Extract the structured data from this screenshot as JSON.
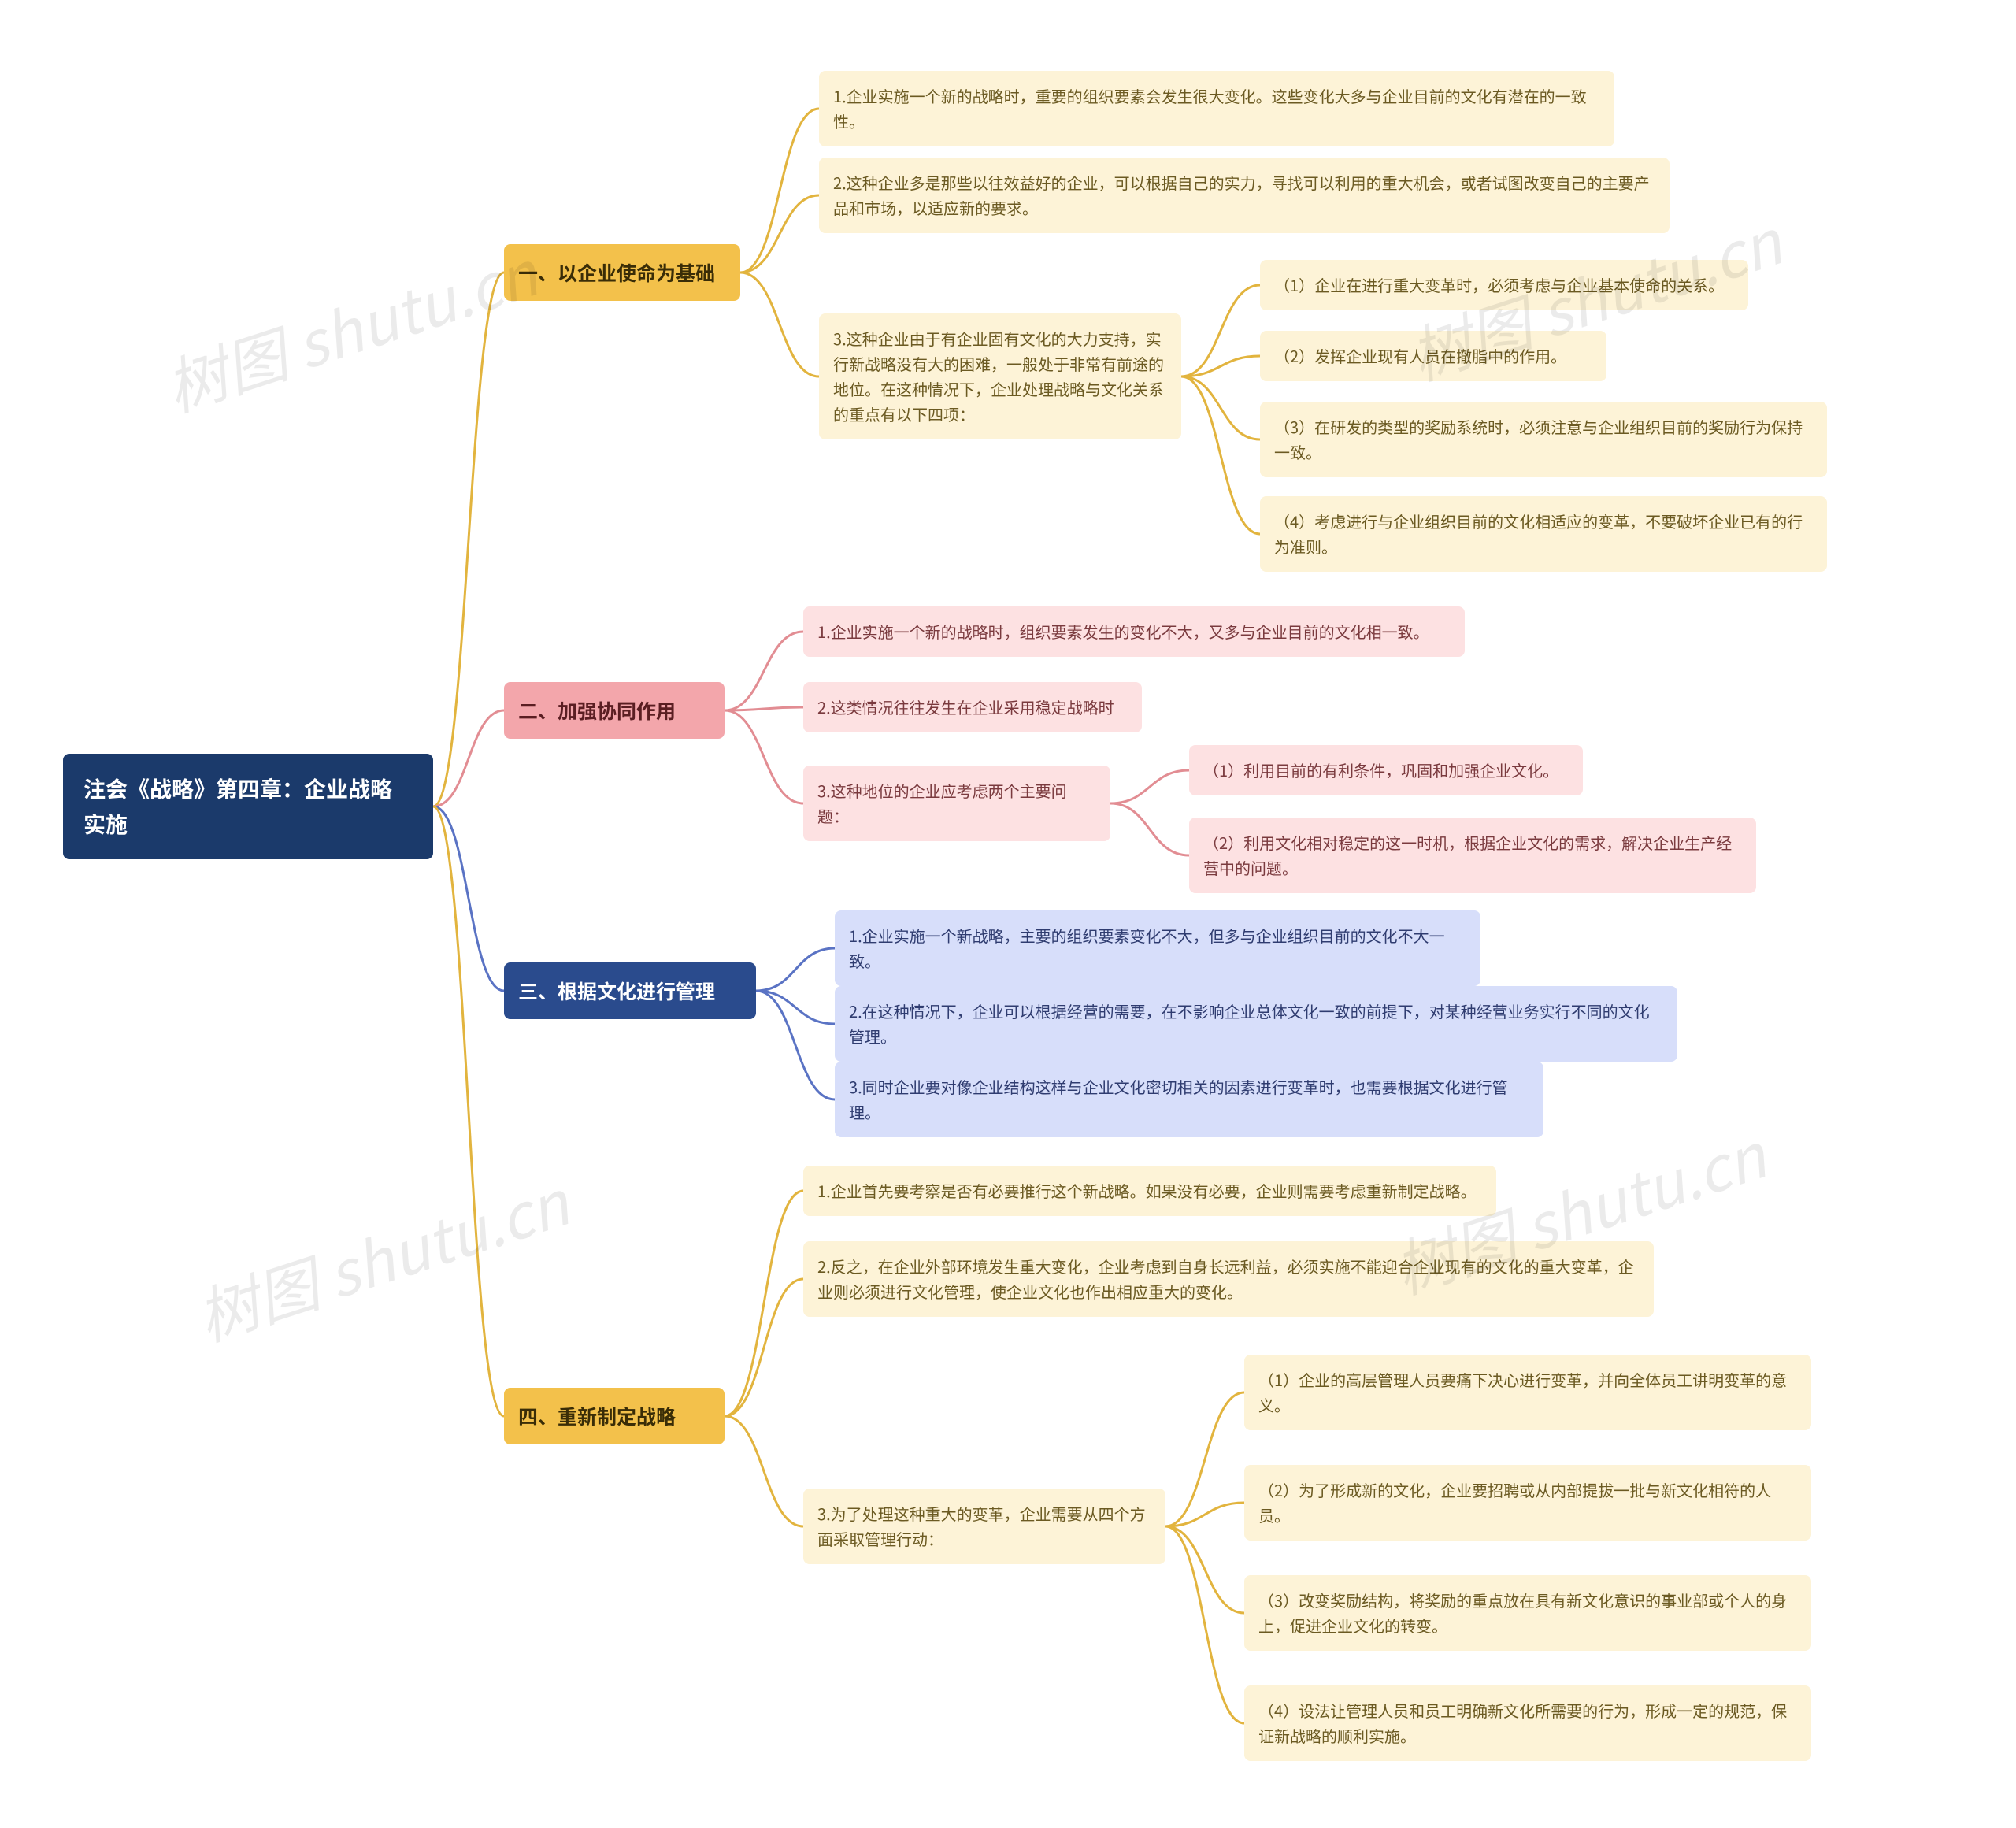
{
  "watermark_text": "树图 shutu.cn",
  "root": {
    "title": "注会《战略》第四章：企业战略实施"
  },
  "branches": [
    {
      "id": "b1",
      "label": "一、以企业使命为基础",
      "color": "yellow",
      "children": [
        {
          "id": "b1c1",
          "text": "1.企业实施一个新的战略时，重要的组织要素会发生很大变化。这些变化大多与企业目前的文化有潜在的一致性。"
        },
        {
          "id": "b1c2",
          "text": "2.这种企业多是那些以往效益好的企业，可以根据自己的实力，寻找可以利用的重大机会，或者试图改变自己的主要产品和市场，以适应新的要求。"
        },
        {
          "id": "b1c3",
          "text": "3.这种企业由于有企业固有文化的大力支持，实行新战略没有大的困难，一般处于非常有前途的地位。在这种情况下，企业处理战略与文化关系的重点有以下四项：",
          "children": [
            {
              "id": "b1c3a",
              "text": "（1）企业在进行重大变革时，必须考虑与企业基本使命的关系。"
            },
            {
              "id": "b1c3b",
              "text": "（2）发挥企业现有人员在撤脂中的作用。"
            },
            {
              "id": "b1c3c",
              "text": "（3）在研发的类型的奖励系统时，必须注意与企业组织目前的奖励行为保持一致。"
            },
            {
              "id": "b1c3d",
              "text": "（4）考虑进行与企业组织目前的文化相适应的变革，不要破坏企业已有的行为准则。"
            }
          ]
        }
      ]
    },
    {
      "id": "b2",
      "label": "二、加强协同作用",
      "color": "pink",
      "children": [
        {
          "id": "b2c1",
          "text": "1.企业实施一个新的战略时，组织要素发生的变化不大，又多与企业目前的文化相一致。"
        },
        {
          "id": "b2c2",
          "text": "2.这类情况往往发生在企业采用稳定战略时"
        },
        {
          "id": "b2c3",
          "text": "3.这种地位的企业应考虑两个主要问题：",
          "children": [
            {
              "id": "b2c3a",
              "text": "（1）利用目前的有利条件，巩固和加强企业文化。"
            },
            {
              "id": "b2c3b",
              "text": "（2）利用文化相对稳定的这一时机，根据企业文化的需求，解决企业生产经营中的问题。"
            }
          ]
        }
      ]
    },
    {
      "id": "b3",
      "label": "三、根据文化进行管理",
      "color": "blue",
      "children": [
        {
          "id": "b3c1",
          "text": "1.企业实施一个新战略，主要的组织要素变化不大，但多与企业组织目前的文化不大一致。"
        },
        {
          "id": "b3c2",
          "text": "2.在这种情况下，企业可以根据经营的需要，在不影响企业总体文化一致的前提下，对某种经营业务实行不同的文化管理。"
        },
        {
          "id": "b3c3",
          "text": "3.同时企业要对像企业结构这样与企业文化密切相关的因素进行变革时，也需要根据文化进行管理。"
        }
      ]
    },
    {
      "id": "b4",
      "label": "四、重新制定战略",
      "color": "yellow",
      "children": [
        {
          "id": "b4c1",
          "text": "1.企业首先要考察是否有必要推行这个新战略。如果没有必要，企业则需要考虑重新制定战略。"
        },
        {
          "id": "b4c2",
          "text": "2.反之，在企业外部环境发生重大变化，企业考虑到自身长远利益，必须实施不能迎合企业现有的文化的重大变革，企业则必须进行文化管理，使企业文化也作出相应重大的变化。"
        },
        {
          "id": "b4c3",
          "text": "3.为了处理这种重大的变革，企业需要从四个方面采取管理行动：",
          "children": [
            {
              "id": "b4c3a",
              "text": "（1）企业的高层管理人员要痛下决心进行变革，并向全体员工讲明变革的意义。"
            },
            {
              "id": "b4c3b",
              "text": "（2）为了形成新的文化，企业要招聘或从内部提拔一批与新文化相符的人员。"
            },
            {
              "id": "b4c3c",
              "text": "（3）改变奖励结构，将奖励的重点放在具有新文化意识的事业部或个人的身上，促进企业文化的转变。"
            },
            {
              "id": "b4c3d",
              "text": "（4）设法让管理人员和员工明确新文化所需要的行为，形成一定的规范，保证新战略的顺利实施。"
            }
          ]
        }
      ]
    }
  ],
  "colors": {
    "yellow_stroke": "#e2b43e",
    "pink_stroke": "#e28d93",
    "blue_stroke": "#5a73c4"
  }
}
